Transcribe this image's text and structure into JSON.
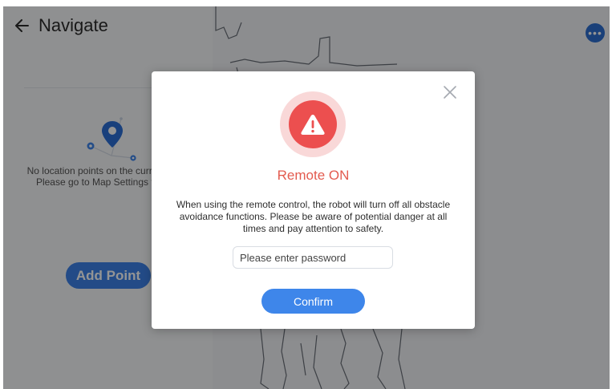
{
  "header": {
    "title": "Navigate",
    "back_icon": "arrow-left-icon"
  },
  "left_panel": {
    "empty_message": "No location points on the current map. Please go to Map Settings to add.",
    "add_button_label": "Add Point",
    "illustration_icon": "location-pin-icon"
  },
  "map": {
    "more_icon": "more-dots-icon",
    "more_glyph": "•••"
  },
  "dialog": {
    "title": "Remote ON",
    "message": "When using the remote control, the robot will turn off all obstacle avoidance functions. Please be aware of potential danger at all times and pay attention to safety.",
    "password_placeholder": "Please enter password",
    "password_value": "",
    "confirm_label": "Confirm",
    "close_icon": "close-icon",
    "warning_icon": "warning-triangle-icon"
  },
  "colors": {
    "accent": "#3e86ea",
    "title_red": "#e35b4f",
    "warning_red": "#ec4f4f",
    "warning_ring": "#f9d8d8"
  }
}
